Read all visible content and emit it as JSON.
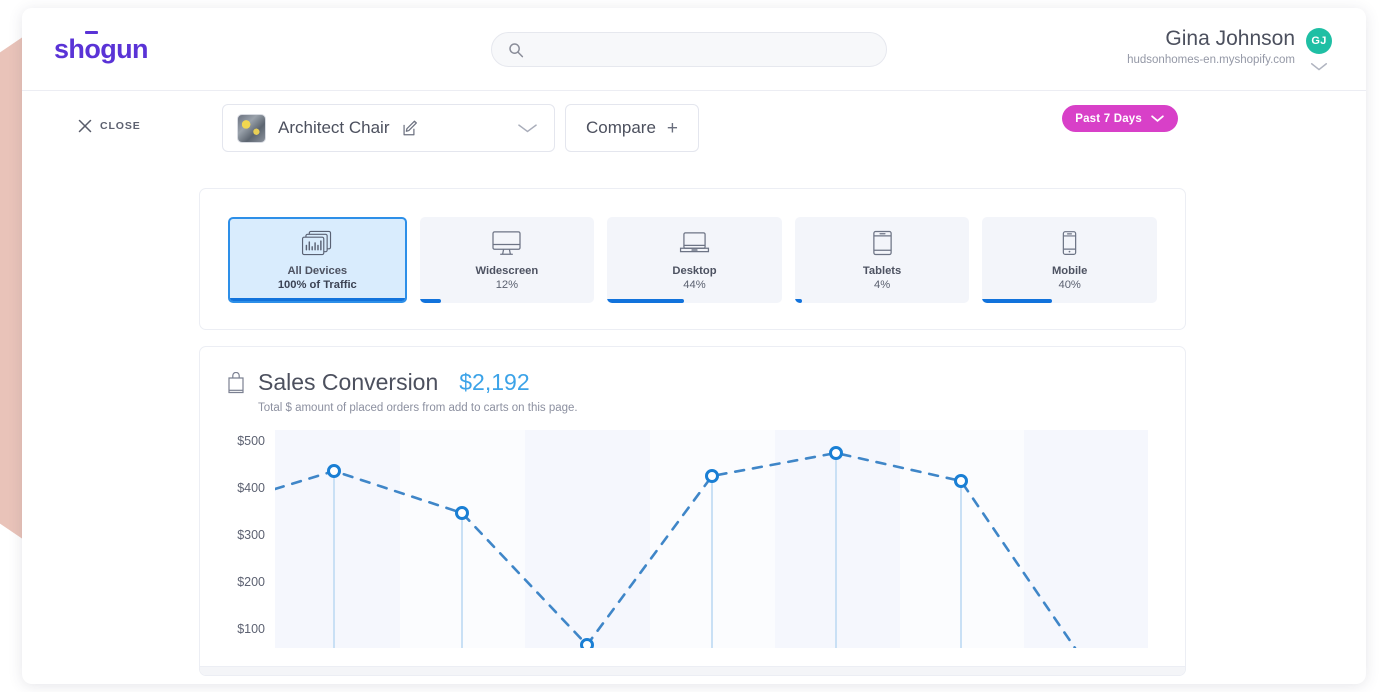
{
  "header": {
    "logo_text": "shogun",
    "logo_pre": "sh",
    "logo_macron": "o",
    "logo_post": "gun",
    "search": {
      "value": "",
      "placeholder": "",
      "icon": "search-icon"
    },
    "user": {
      "name": "Gina Johnson",
      "shop": "hudsonhomes-en.myshopify.com",
      "avatar_initials": "GJ",
      "avatar_color": "#1fbfa4",
      "caret_icon": "chevron-down-icon"
    }
  },
  "toolbar": {
    "close_label": "CLOSE",
    "close_icon": "close-x-icon",
    "product_name": "Architect Chair",
    "product_thumb_icon": "product-thumbnail",
    "edit_icon": "edit-pencil-icon",
    "product_caret_icon": "chevron-down-icon",
    "compare_label": "Compare",
    "compare_plus": "+",
    "date_range_label": "Past 7 Days",
    "date_range_caret_icon": "chevron-down-icon",
    "date_range_color": "#d840c8"
  },
  "devices": {
    "accent_color": "#1273dc",
    "selected_index": 0,
    "tiles": [
      {
        "label": "All Devices",
        "sub": "100% of Traffic",
        "percent": 100,
        "icon": "all-devices-chart-icon",
        "selected": true
      },
      {
        "label": "Widescreen",
        "sub": "12%",
        "percent": 12,
        "icon": "widescreen-monitor-icon",
        "selected": false
      },
      {
        "label": "Desktop",
        "sub": "44%",
        "percent": 44,
        "icon": "desktop-laptop-icon",
        "selected": false
      },
      {
        "label": "Tablets",
        "sub": "4%",
        "percent": 4,
        "icon": "tablet-icon",
        "selected": false
      },
      {
        "label": "Mobile",
        "sub": "40%",
        "percent": 40,
        "icon": "mobile-phone-icon",
        "selected": false
      }
    ]
  },
  "chart_card": {
    "icon": "shopping-bag-icon",
    "title": "Sales Conversion",
    "value": "$2,192",
    "value_color": "#3ca3e8",
    "subtitle": "Total $ amount of placed orders from add to carts on this page."
  },
  "chart_data": {
    "type": "line",
    "title": "Sales Conversion",
    "xlabel": "",
    "ylabel": "",
    "ylim": [
      0,
      550
    ],
    "ytick_labels": [
      "$500",
      "$400",
      "$300",
      "$200",
      "$100"
    ],
    "ytick_values": [
      500,
      400,
      300,
      200,
      100
    ],
    "grid": false,
    "legend": "none",
    "line_style": "dashed",
    "line_color": "#3f86c8",
    "marker_color": "#1a7fd4",
    "band_colors": [
      "#f5f7fd",
      "#fbfcfe"
    ],
    "x": [
      1,
      2,
      3,
      4,
      5,
      6,
      7
    ],
    "values": [
      438,
      349,
      68,
      428,
      477,
      417,
      60
    ],
    "series": [
      {
        "name": "Sales Conversion",
        "values": [
          438,
          349,
          68,
          428,
          477,
          417,
          60
        ]
      }
    ],
    "total": "$2,192"
  }
}
